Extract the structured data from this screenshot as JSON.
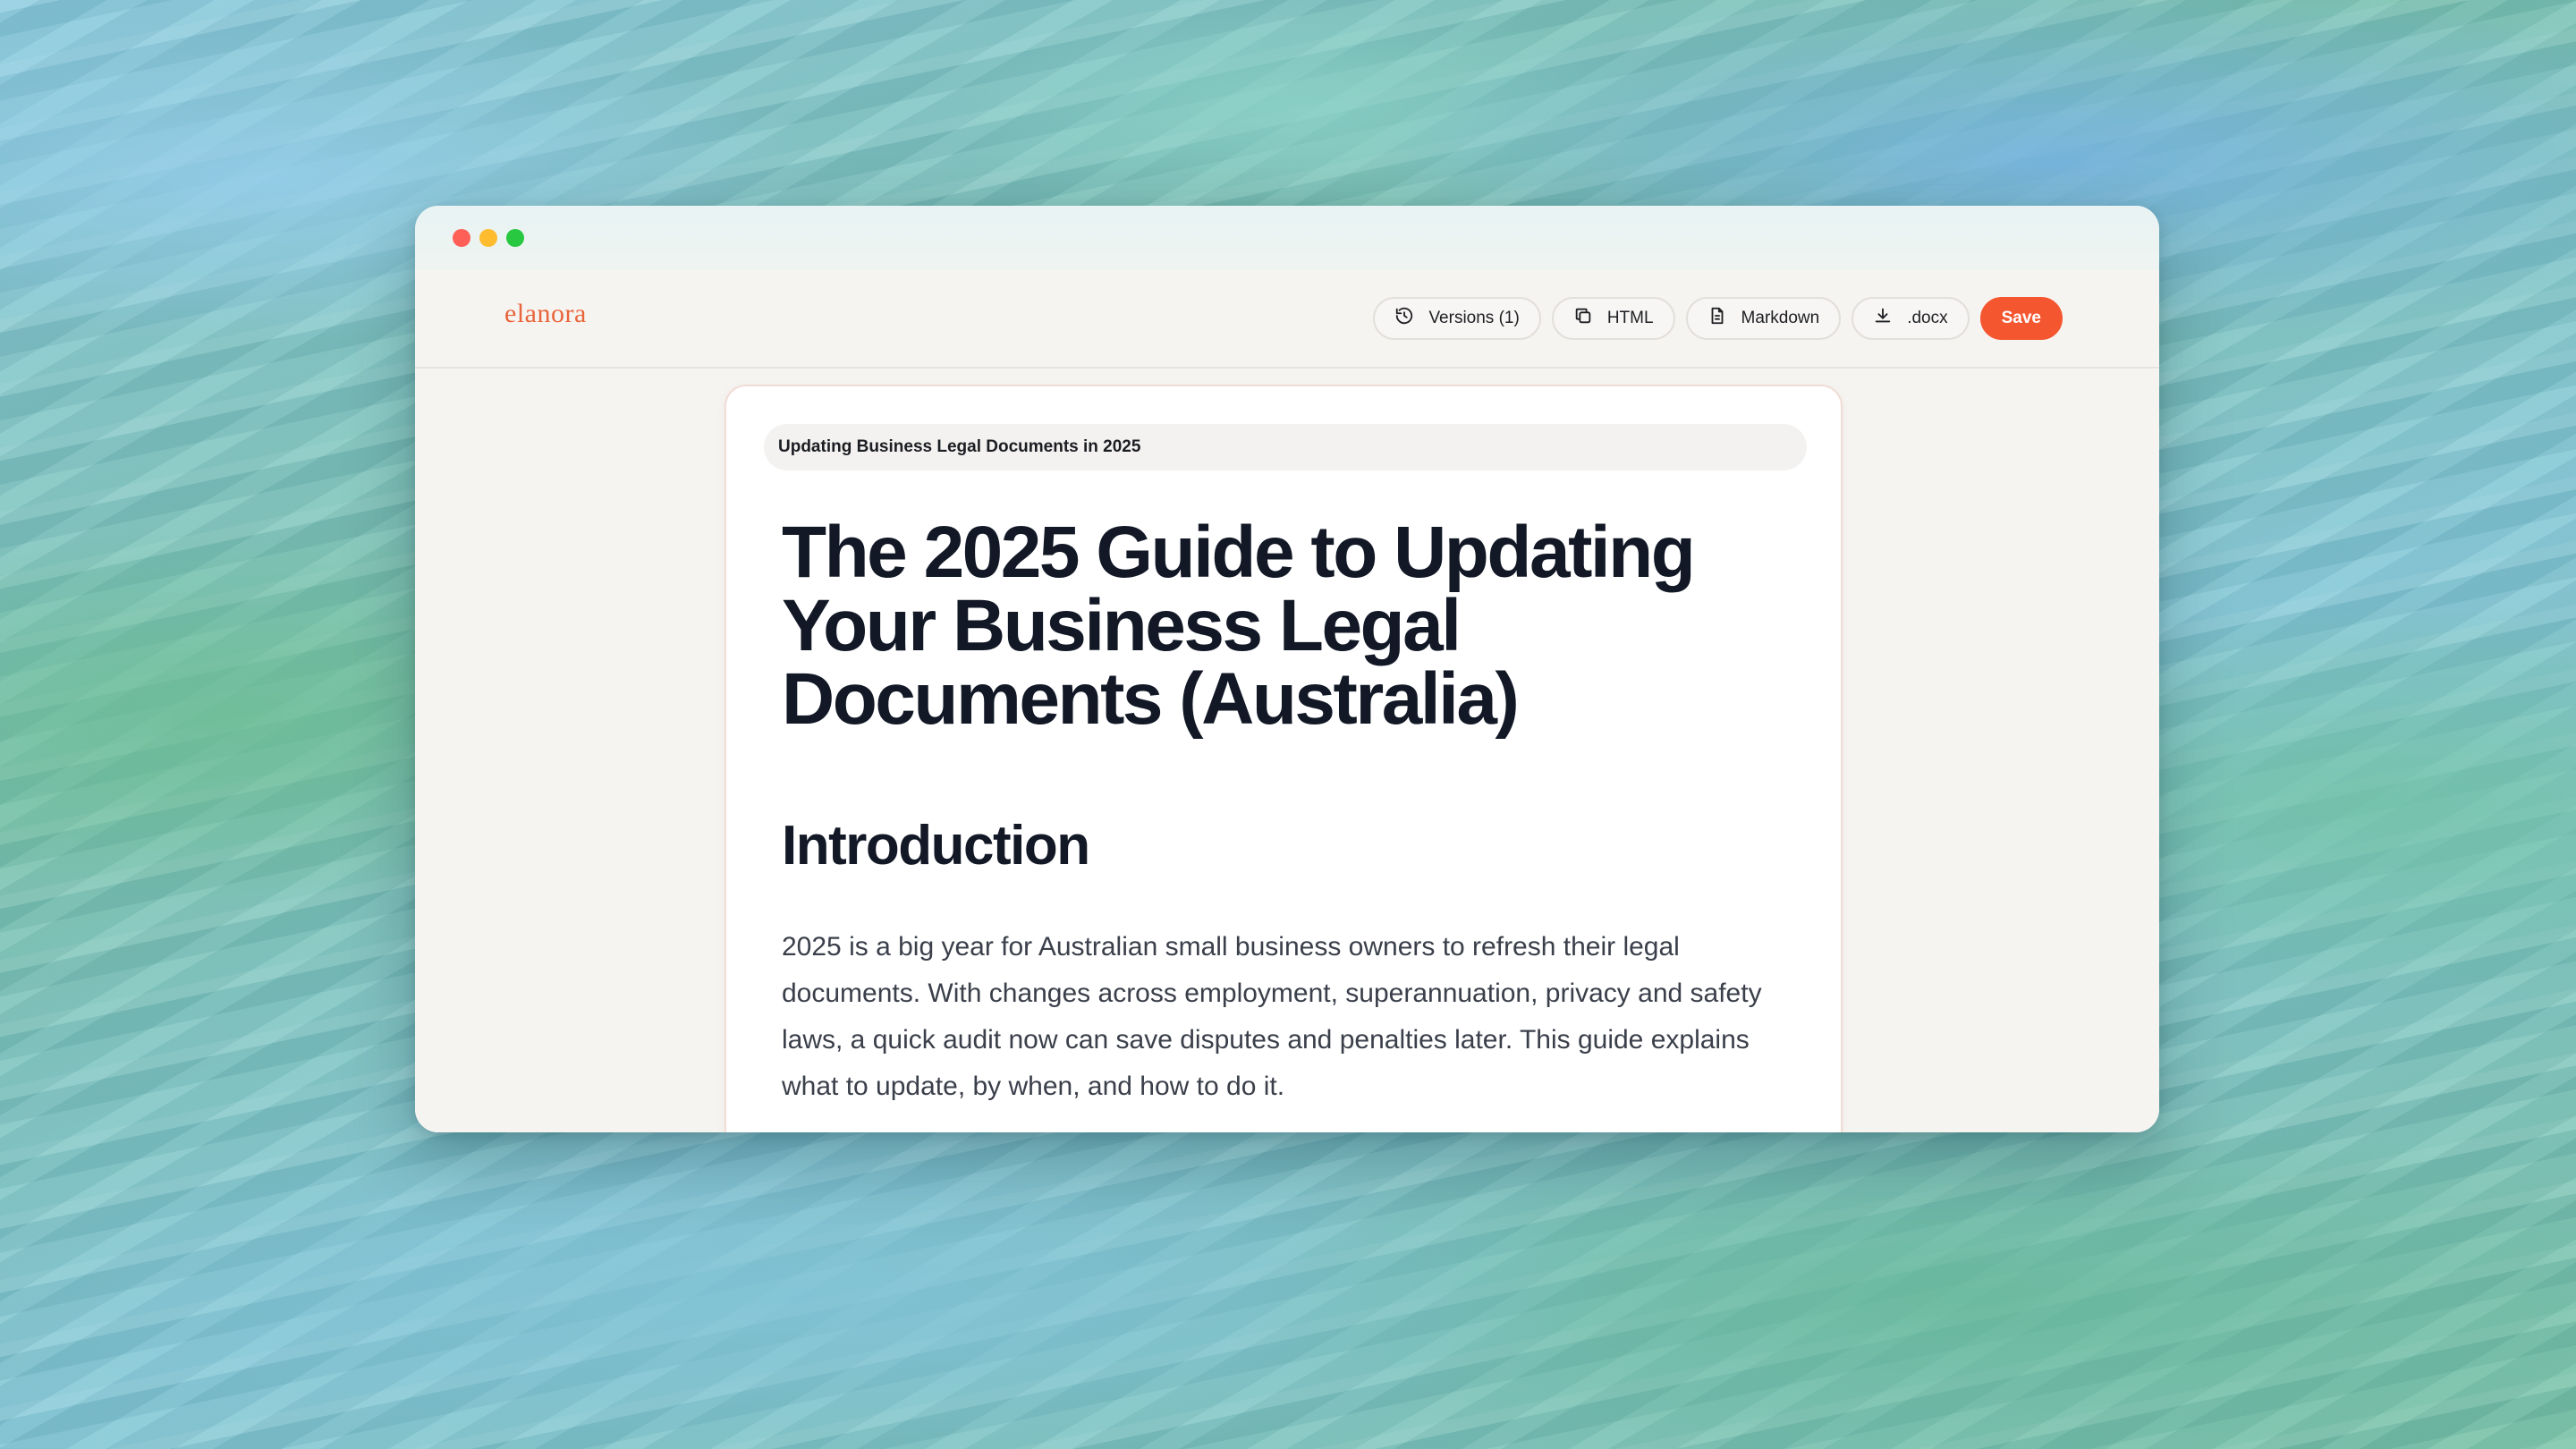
{
  "app": {
    "logo": "elanora"
  },
  "toolbar": {
    "versions_label": "Versions (1)",
    "html_label": "HTML",
    "markdown_label": "Markdown",
    "docx_label": ".docx",
    "save_label": "Save"
  },
  "document": {
    "title_field": "Updating Business Legal Documents in 2025",
    "heading": "The 2025 Guide to Updating Your Business Legal Documents (Australia)",
    "section_heading": "Introduction",
    "paragraph": "2025 is a big year for Australian small business owners to refresh their legal documents. With changes across employment, superannuation, privacy and safety laws, a quick audit now can save disputes and penalties later. This guide explains what to update, by when, and how to do it."
  },
  "colors": {
    "accent": "#f4562f",
    "logo": "#e8643a",
    "heading": "#121826"
  },
  "icons": [
    "history-icon",
    "copy-icon",
    "document-icon",
    "download-icon"
  ]
}
